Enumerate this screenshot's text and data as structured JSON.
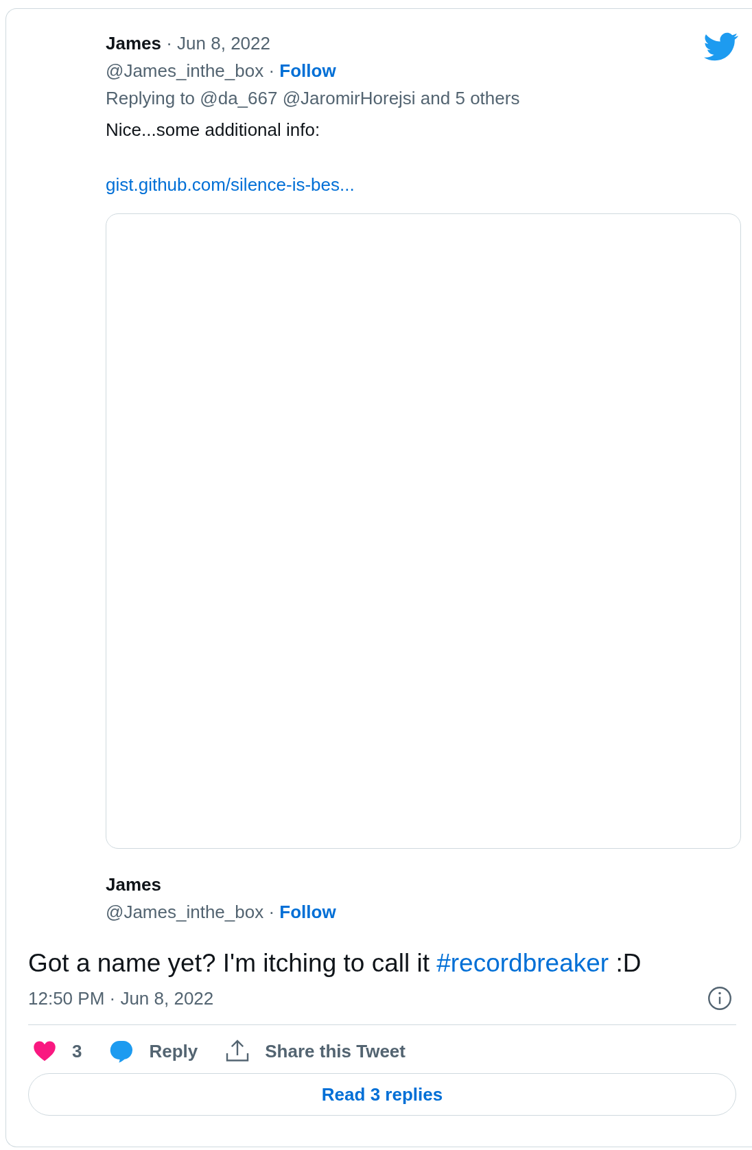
{
  "quoted_tweet": {
    "name": "James",
    "date": "· Jun 8, 2022",
    "handle": "@James_inthe_box",
    "separator": "·",
    "follow": "Follow",
    "replying_to": "Replying to @da_667 @JaromirHorejsi and 5 others",
    "text": "Nice...some additional info:",
    "link": "gist.github.com/silence-is-bes..."
  },
  "embed_author": {
    "name": "James",
    "handle": "@James_inthe_box",
    "separator": "·",
    "follow": "Follow"
  },
  "tweet": {
    "text": "Got a name yet?  I'm itching to call it ",
    "hashtag": "#recordbreaker",
    "text_end": " :D",
    "timestamp": "12:50 PM · Jun 8, 2022"
  },
  "actions": [
    {
      "kind": "like",
      "label": "3"
    },
    {
      "kind": "reply",
      "label": "Reply"
    },
    {
      "kind": "share",
      "label": "Share this Tweet"
    }
  ],
  "read_replies": "Read 3 replies"
}
